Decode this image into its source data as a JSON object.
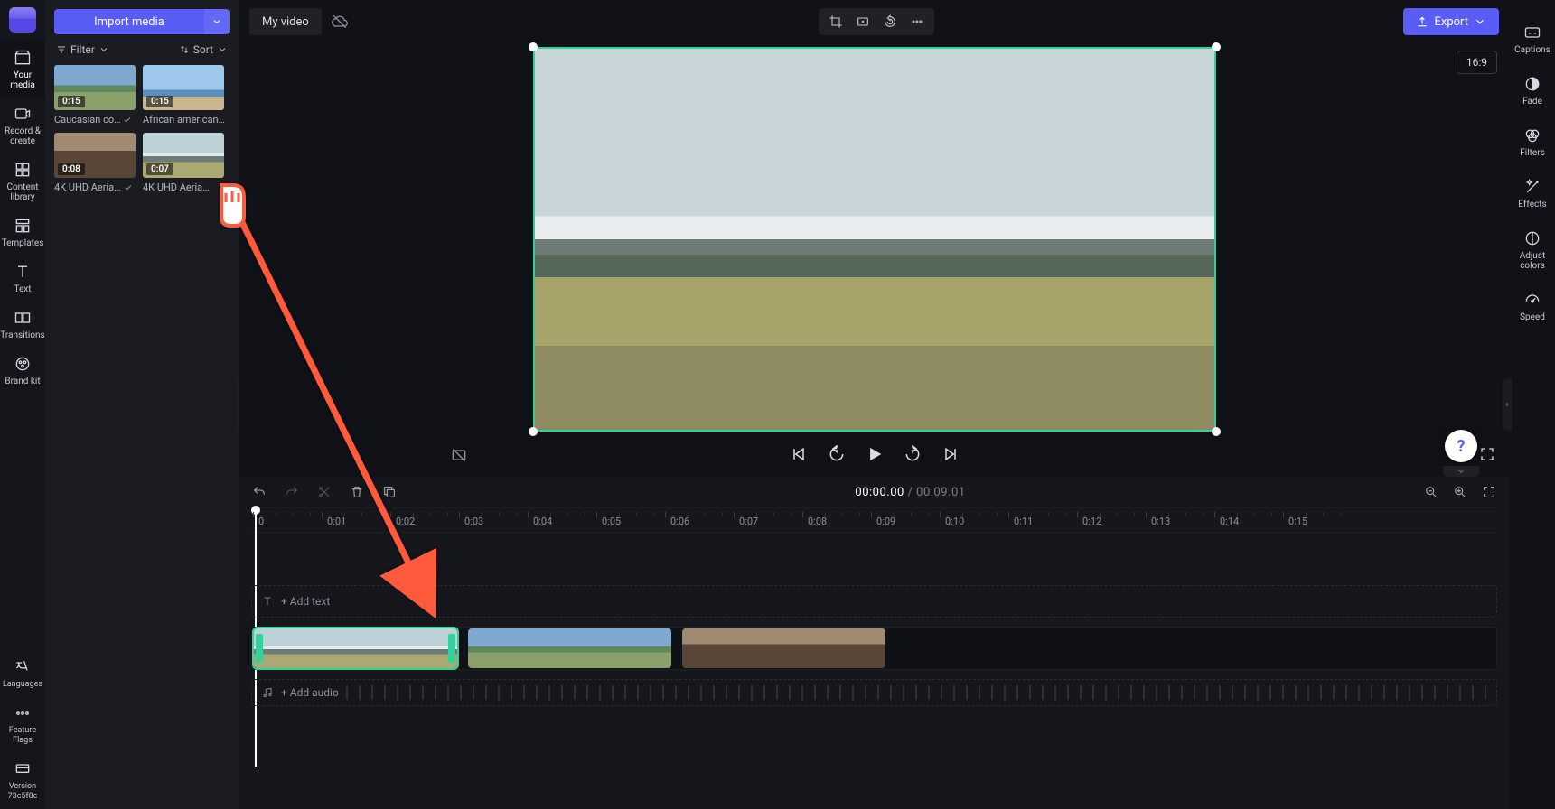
{
  "leftRail": {
    "yourMedia": "Your media",
    "record": "Record & create",
    "library": "Content library",
    "templates": "Templates",
    "text": "Text",
    "transitions": "Transitions",
    "brand": "Brand kit",
    "languages": "Languages",
    "flags": "Feature Flags",
    "version": "Version 73c5f8c"
  },
  "panel": {
    "importLabel": "Import media",
    "filterLabel": "Filter",
    "sortLabel": "Sort",
    "items": [
      {
        "dur": "0:15",
        "name": "Caucasian co…",
        "used": true
      },
      {
        "dur": "0:15",
        "name": "African american…",
        "used": false
      },
      {
        "dur": "0:08",
        "name": "4K UHD Aeria…",
        "used": true
      },
      {
        "dur": "0:07",
        "name": "4K UHD Aeria…",
        "used": false
      }
    ]
  },
  "stage": {
    "title": "My video",
    "exportLabel": "Export",
    "aspect": "16:9"
  },
  "timeline": {
    "current": "00:00.00",
    "duration": "00:09.01",
    "addText": "+ Add text",
    "addAudio": "+ Add audio",
    "ticks": [
      "0",
      "0:01",
      "0:02",
      "0:03",
      "0:04",
      "0:05",
      "0:06",
      "0:07",
      "0:08",
      "0:09",
      "0:10",
      "0:11",
      "0:12",
      "0:13",
      "0:14",
      "0:15"
    ]
  },
  "rightRail": {
    "captions": "Captions",
    "fade": "Fade",
    "filters": "Filters",
    "effects": "Effects",
    "adjust": "Adjust colors",
    "speed": "Speed"
  },
  "help": "?"
}
